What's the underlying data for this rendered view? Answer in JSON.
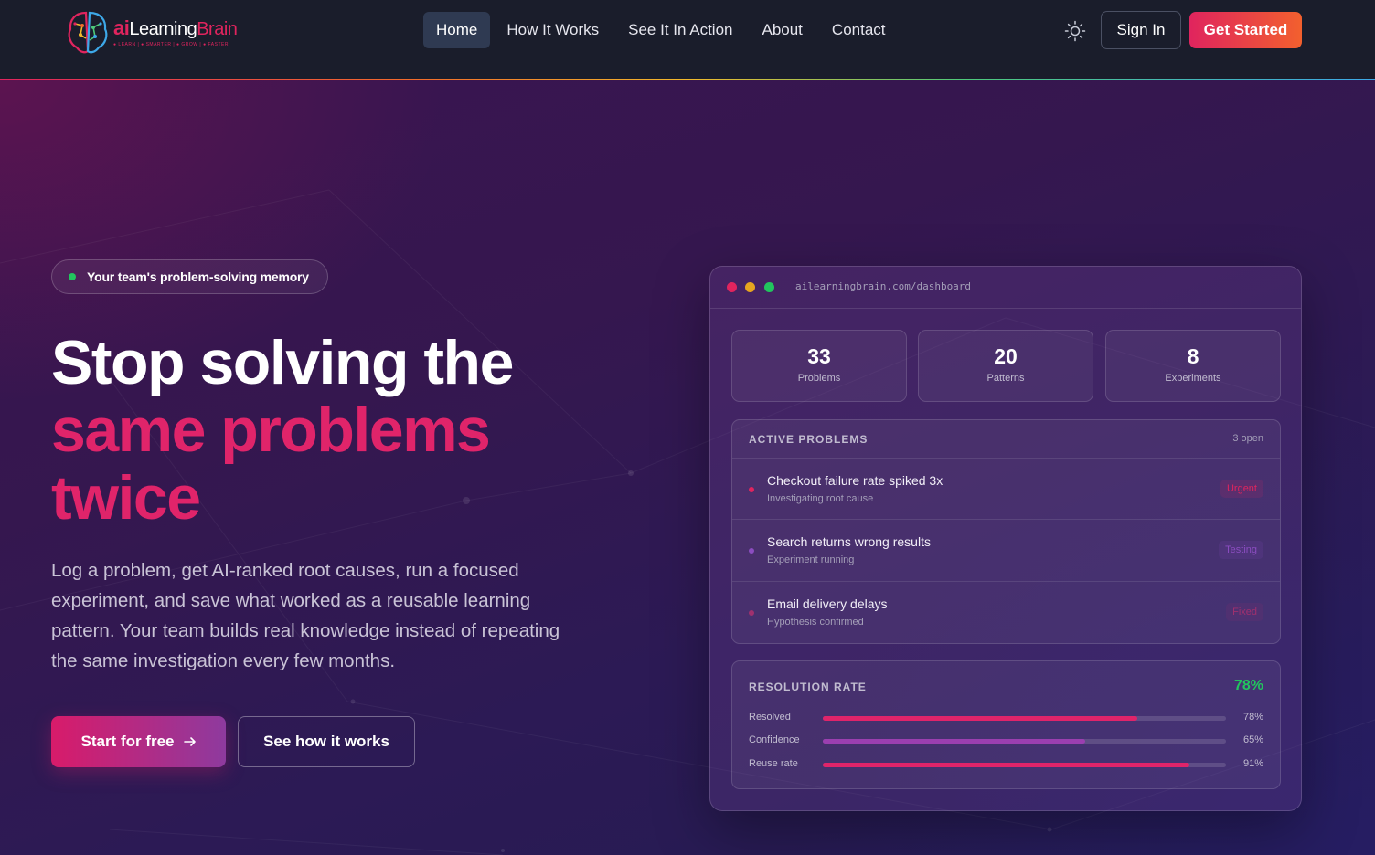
{
  "logo": {
    "ai": "ai",
    "learning": "Learning",
    "brain": "Brain",
    "tagline": "● LEARN | ● SMARTER | ● GROW | ● FASTER"
  },
  "nav": {
    "links": [
      {
        "label": "Home",
        "active": true
      },
      {
        "label": "How It Works",
        "active": false
      },
      {
        "label": "See It In Action",
        "active": false
      },
      {
        "label": "About",
        "active": false
      },
      {
        "label": "Contact",
        "active": false
      }
    ],
    "theme_icon": "sun-icon",
    "sign_in": "Sign In",
    "get_started": "Get Started"
  },
  "hero": {
    "badge": "Your team's problem-solving memory",
    "headline_line1": "Stop solving the",
    "headline_line2": "same problems",
    "headline_line3": "twice",
    "lead": "Log a problem, get AI-ranked root causes, run a focused experiment, and save what worked as a reusable learning pattern. Your team builds real knowledge instead of repeating the same investigation every few months.",
    "cta_primary": "Start for free",
    "cta_primary_icon": "arrow-right-icon",
    "cta_secondary": "See how it works"
  },
  "dashboard": {
    "url": "ailearningbrain.com/dashboard",
    "stats": [
      {
        "value": "33",
        "label": "Problems"
      },
      {
        "value": "20",
        "label": "Patterns"
      },
      {
        "value": "8",
        "label": "Experiments"
      }
    ],
    "active_problems": {
      "title": "ACTIVE PROBLEMS",
      "meta": "3 open",
      "items": [
        {
          "title": "Checkout failure rate spiked 3x",
          "subtitle": "Investigating root cause",
          "status": "Urgent",
          "color": "#e0245e"
        },
        {
          "title": "Search returns wrong results",
          "subtitle": "Experiment running",
          "status": "Testing",
          "color": "#8b4dc0"
        },
        {
          "title": "Email delivery delays",
          "subtitle": "Hypothesis confirmed",
          "status": "Fixed",
          "color": "#a0306e"
        }
      ]
    },
    "resolution": {
      "title": "RESOLUTION RATE",
      "value": "78%",
      "bars": [
        {
          "label": "Resolved",
          "percent": 78,
          "display": "78%",
          "color": "#e0246a"
        },
        {
          "label": "Confidence",
          "percent": 65,
          "display": "65%",
          "color": "#9b3fb0"
        },
        {
          "label": "Reuse rate",
          "percent": 91,
          "display": "91%",
          "color": "#e0246a"
        }
      ]
    }
  },
  "colors": {
    "accent": "#e0245e",
    "success": "#22c55e",
    "nav_bg": "#1a1d2b"
  }
}
